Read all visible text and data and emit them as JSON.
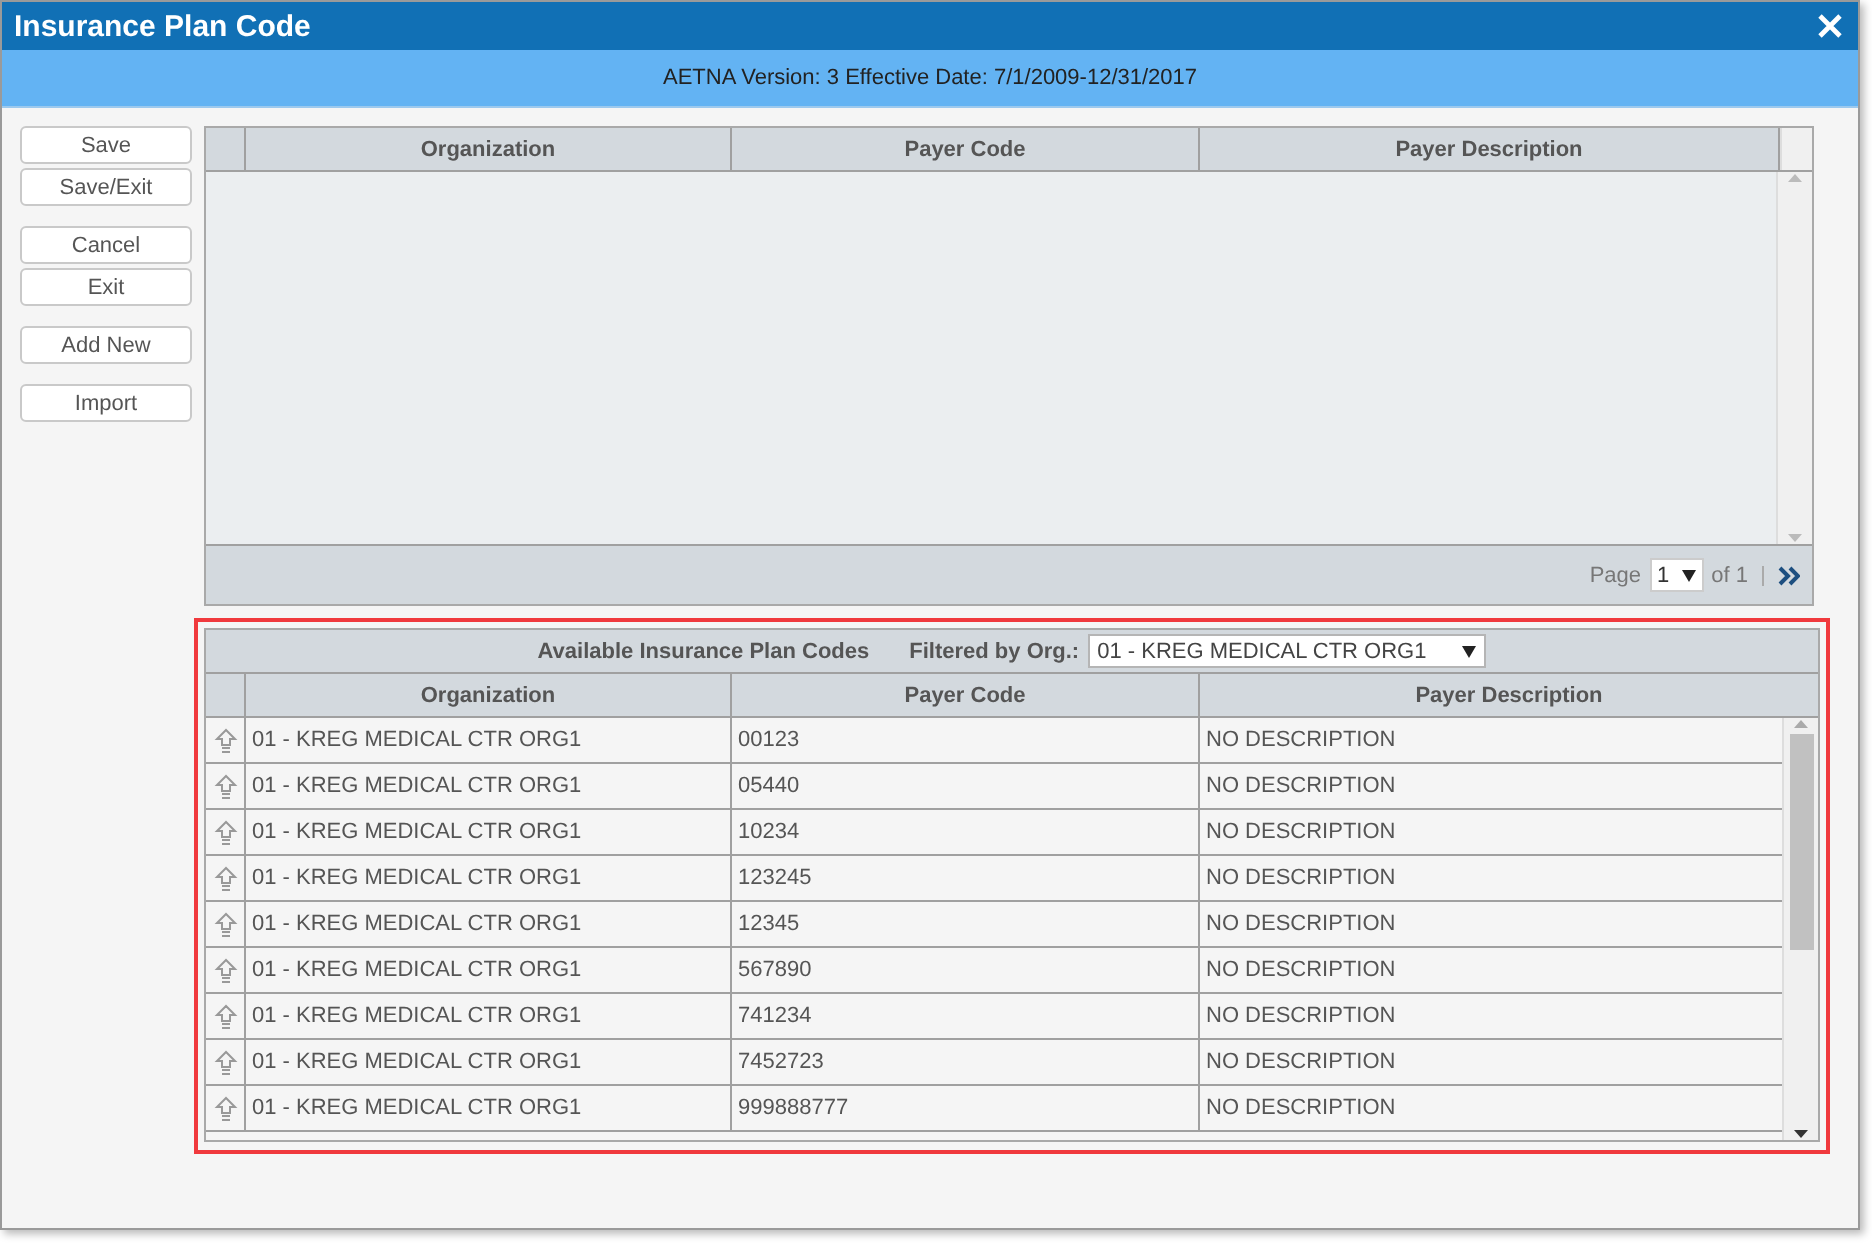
{
  "window": {
    "title": "Insurance Plan Code"
  },
  "subheader": "AETNA Version: 3 Effective Date: 7/1/2009-12/31/2017",
  "button_groups": [
    [
      "Save",
      "Save/Exit"
    ],
    [
      "Cancel",
      "Exit"
    ],
    [
      "Add New"
    ],
    [
      "Import"
    ]
  ],
  "selected_grid": {
    "columns": [
      "Organization",
      "Payer Code",
      "Payer Description"
    ],
    "pager": {
      "label": "Page",
      "page": "1",
      "of": "of 1"
    }
  },
  "available_grid": {
    "caption": "Available Insurance Plan Codes",
    "filter_label": "Filtered by Org.:",
    "filter_value": "01 - KREG MEDICAL CTR ORG1",
    "columns": [
      "Organization",
      "Payer Code",
      "Payer Description"
    ],
    "rows": [
      {
        "organization": "01 - KREG MEDICAL CTR ORG1",
        "payer_code": "00123",
        "payer_description": "NO DESCRIPTION"
      },
      {
        "organization": "01 - KREG MEDICAL CTR ORG1",
        "payer_code": "05440",
        "payer_description": "NO DESCRIPTION"
      },
      {
        "organization": "01 - KREG MEDICAL CTR ORG1",
        "payer_code": "10234",
        "payer_description": "NO DESCRIPTION"
      },
      {
        "organization": "01 - KREG MEDICAL CTR ORG1",
        "payer_code": "123245",
        "payer_description": "NO DESCRIPTION"
      },
      {
        "organization": "01 - KREG MEDICAL CTR ORG1",
        "payer_code": "12345",
        "payer_description": "NO DESCRIPTION"
      },
      {
        "organization": "01 - KREG MEDICAL CTR ORG1",
        "payer_code": "567890",
        "payer_description": "NO DESCRIPTION"
      },
      {
        "organization": "01 - KREG MEDICAL CTR ORG1",
        "payer_code": "741234",
        "payer_description": "NO DESCRIPTION"
      },
      {
        "organization": "01 - KREG MEDICAL CTR ORG1",
        "payer_code": "7452723",
        "payer_description": "NO DESCRIPTION"
      },
      {
        "organization": "01 - KREG MEDICAL CTR ORG1",
        "payer_code": "999888777",
        "payer_description": "NO DESCRIPTION"
      }
    ]
  }
}
